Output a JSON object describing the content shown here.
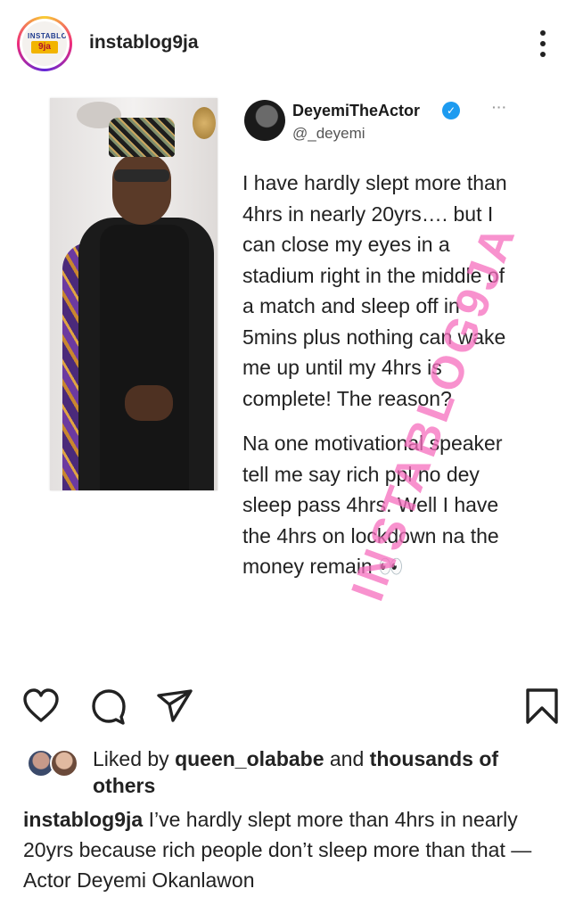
{
  "header": {
    "username": "instablog9ja",
    "avatar_icon": "instablog9ja-logo",
    "more_icon": "more-vertical-icon"
  },
  "post": {
    "tweet": {
      "display_name": "DeyemiTheActor",
      "handle": "@_deyemi",
      "verified_icon": "verified-badge-icon",
      "more_icon": "more-horizontal-icon",
      "paragraph_1": "I have hardly slept more than 4hrs in nearly 20yrs…. but I can close my eyes in a stadium right in the middle of a match and sleep off in 5mins plus nothing can wake me up until my 4hrs is complete! The reason?",
      "paragraph_2": "Na one motivational speaker tell me say rich ppl no dey sleep pass 4hrs. Well I have the 4hrs on lockdown na the money remain 👀"
    },
    "watermark": "INSTABLOG9JA"
  },
  "actions": {
    "like_icon": "heart-icon",
    "comment_icon": "comment-icon",
    "share_icon": "send-icon",
    "save_icon": "bookmark-icon"
  },
  "likes": {
    "prefix": "Liked by",
    "user": "queen_olababe",
    "middle": "and",
    "others": "thousands of others"
  },
  "caption": {
    "username": "instablog9ja",
    "text": "I’ve hardly slept more than 4hrs in nearly 20yrs because rich people don’t sleep more than that — Actor Deyemi Okanlawon"
  },
  "colors": {
    "watermark": "#f66ebe",
    "verified": "#1d9bf0",
    "text": "#222222"
  }
}
